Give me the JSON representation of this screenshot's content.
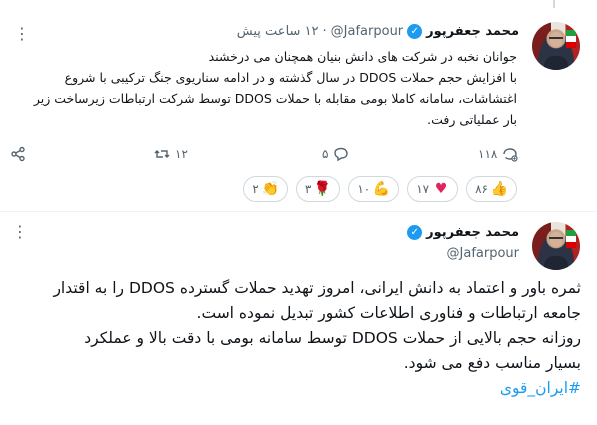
{
  "tweet1": {
    "author_name": "محمد جعفرپور",
    "handle": "@Jafarpour",
    "time": "۱۲ ساعت پیش",
    "body_lines": [
      "جوانان نخبه در شرکت های دانش بنیان همچنان می درخشند",
      "با افزایش حجم حملات DDOS در سال گذشته و در ادامه سناریوی جنگ ترکیبی با شروع",
      "اغتشاشات، سامانه کاملا بومی مقابله با حملات DDOS توسط شرکت ارتباطات زیرساخت زیر",
      "بار عملیاتی رفت."
    ],
    "actions": {
      "views": "۱۱۸",
      "replies": "۵",
      "retweets": "۱۲"
    },
    "reactions": [
      {
        "icon": "thumbs-up-icon",
        "count": "۸۶"
      },
      {
        "icon": "heart-icon",
        "count": "۱۷"
      },
      {
        "icon": "flexed-biceps-icon",
        "count": "۱۰"
      },
      {
        "icon": "rose-icon",
        "count": "۳"
      },
      {
        "icon": "clapping-hands-icon",
        "count": "۲"
      }
    ]
  },
  "tweet2": {
    "author_name": "محمد جعفرپور",
    "handle": "@Jafarpour",
    "body_lines": [
      "ثمره باور و اعتماد به دانش ایرانی، امروز تهدید حملات گسترده DDOS را به  اقتدار",
      "جامعه ارتباطات و فناوری اطلاعات کشور تبدیل نموده است.",
      "روزانه حجم بالایی از حملات DDOS توسط سامانه بومی با دقت بالا و عملکرد",
      "بسیار مناسب دفع می شود."
    ],
    "hashtag": "#ایران_قوی"
  },
  "colors": {
    "accent": "#1d9bf0",
    "muted": "#536471",
    "text": "#0f1419"
  }
}
